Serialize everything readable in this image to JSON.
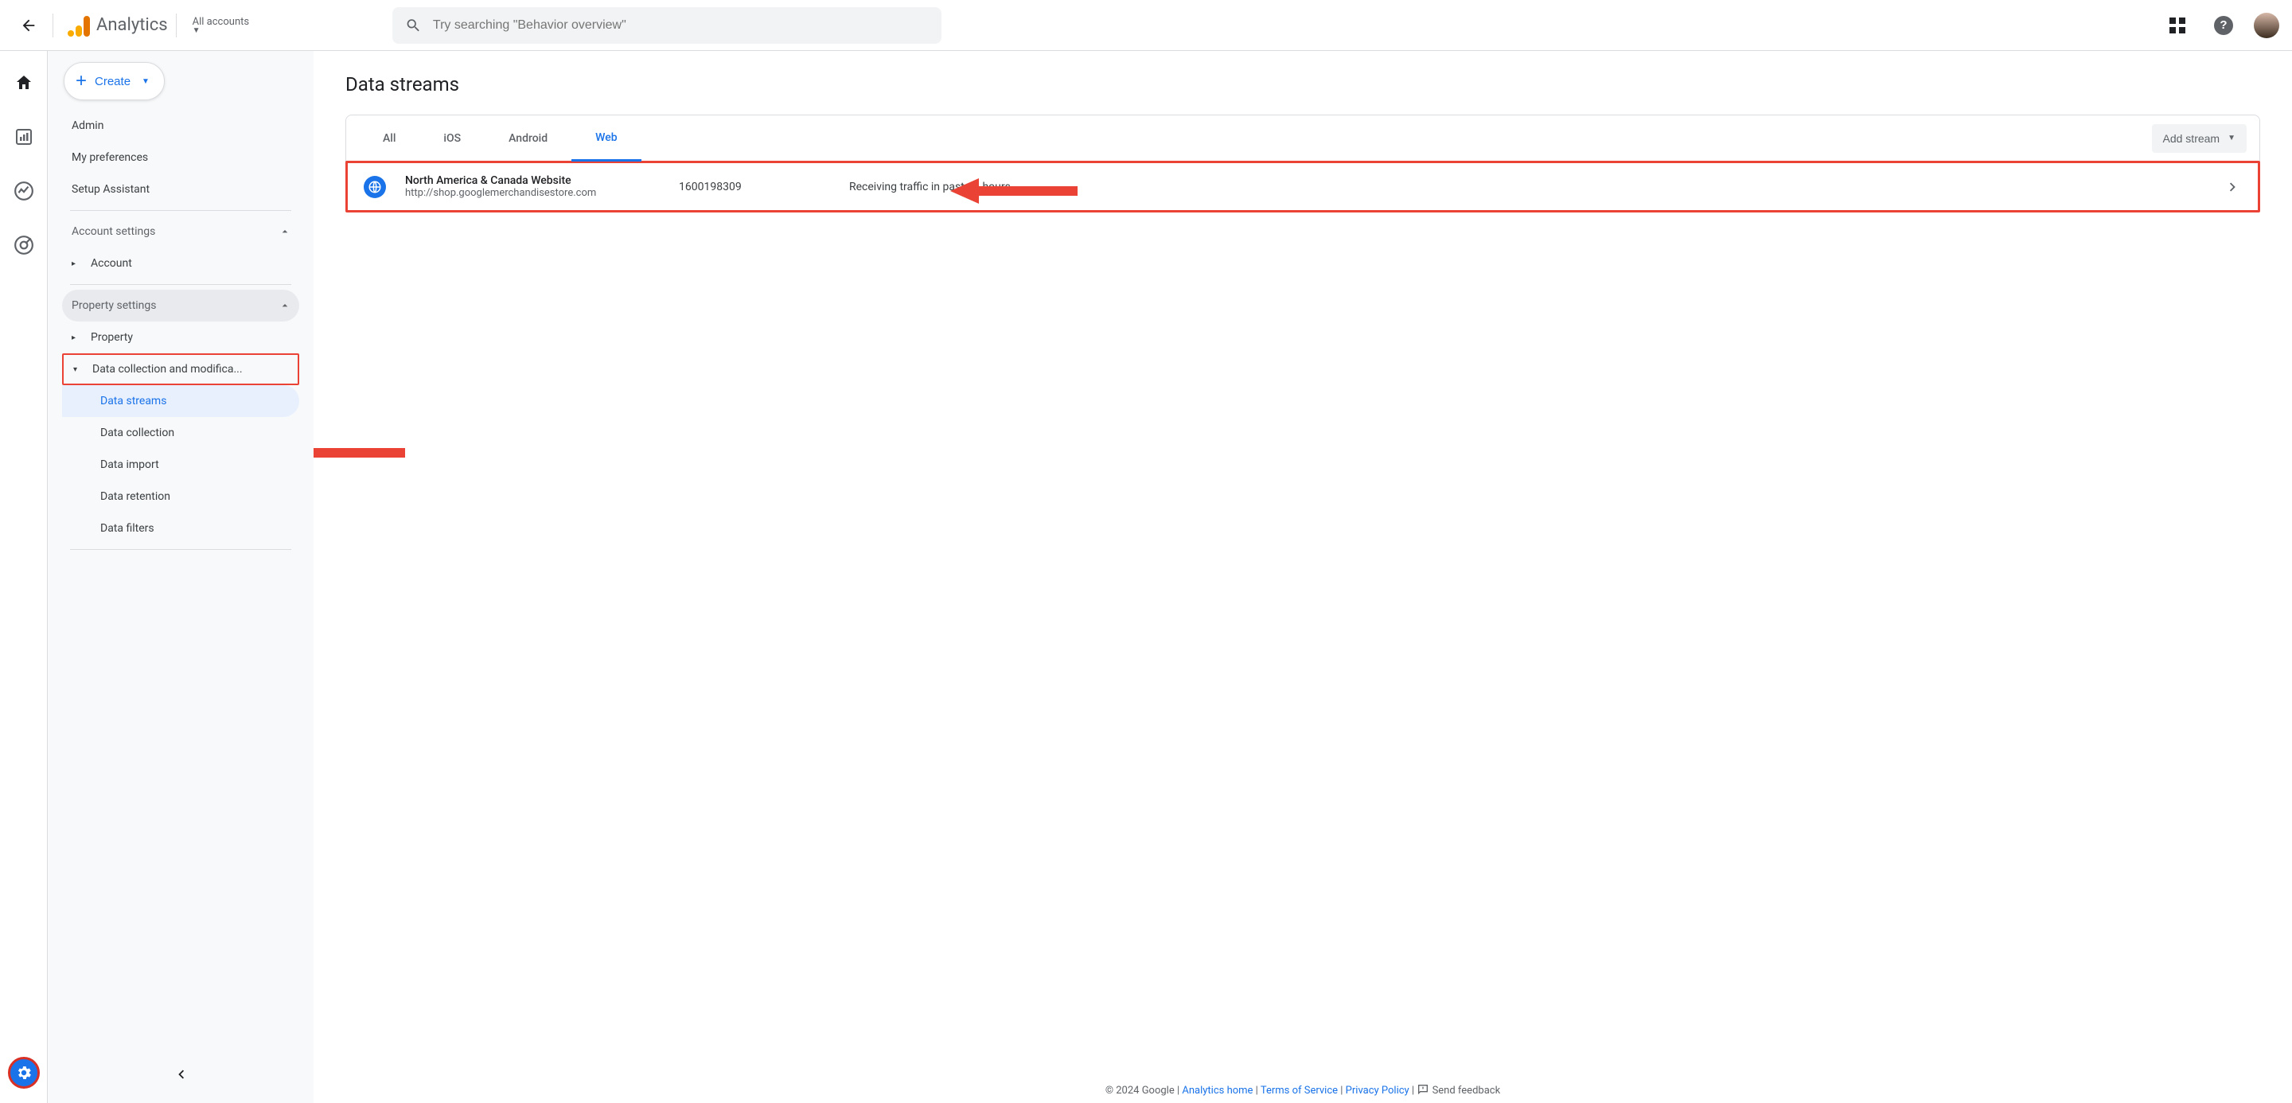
{
  "header": {
    "app_title": "Analytics",
    "account_label": "All accounts",
    "search_placeholder": "Try searching \"Behavior overview\""
  },
  "sidebar": {
    "create_label": "Create",
    "top_items": [
      "Admin",
      "My preferences",
      "Setup Assistant"
    ],
    "account_settings_label": "Account settings",
    "account_label": "Account",
    "property_settings_label": "Property settings",
    "property_label": "Property",
    "data_collection_group": "Data collection and modifica...",
    "leaves": {
      "data_streams": "Data streams",
      "data_collection": "Data collection",
      "data_import": "Data import",
      "data_retention": "Data retention",
      "data_filters": "Data filters"
    }
  },
  "main": {
    "page_title": "Data streams",
    "tabs": {
      "all": "All",
      "ios": "iOS",
      "android": "Android",
      "web": "Web"
    },
    "add_stream_label": "Add stream",
    "stream": {
      "name": "North America & Canada Website",
      "url": "http://shop.googlemerchandisestore.com",
      "id": "1600198309",
      "status": "Receiving traffic in past 48 hours."
    }
  },
  "footer": {
    "copyright": "© 2024 Google",
    "analytics_home": "Analytics home",
    "tos": "Terms of Service",
    "privacy": "Privacy Policy",
    "feedback": "Send feedback"
  }
}
